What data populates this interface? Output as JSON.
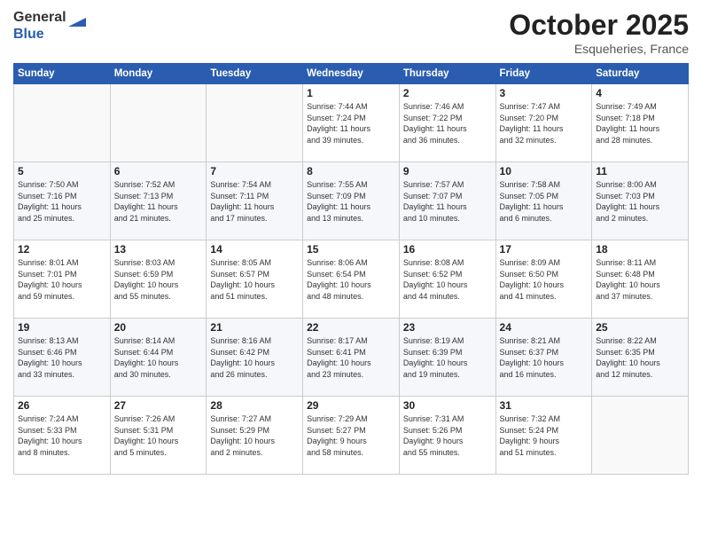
{
  "logo": {
    "general": "General",
    "blue": "Blue"
  },
  "header": {
    "month": "October 2025",
    "location": "Esqueheries, France"
  },
  "weekdays": [
    "Sunday",
    "Monday",
    "Tuesday",
    "Wednesday",
    "Thursday",
    "Friday",
    "Saturday"
  ],
  "weeks": [
    [
      {
        "day": "",
        "info": ""
      },
      {
        "day": "",
        "info": ""
      },
      {
        "day": "",
        "info": ""
      },
      {
        "day": "1",
        "info": "Sunrise: 7:44 AM\nSunset: 7:24 PM\nDaylight: 11 hours\nand 39 minutes."
      },
      {
        "day": "2",
        "info": "Sunrise: 7:46 AM\nSunset: 7:22 PM\nDaylight: 11 hours\nand 36 minutes."
      },
      {
        "day": "3",
        "info": "Sunrise: 7:47 AM\nSunset: 7:20 PM\nDaylight: 11 hours\nand 32 minutes."
      },
      {
        "day": "4",
        "info": "Sunrise: 7:49 AM\nSunset: 7:18 PM\nDaylight: 11 hours\nand 28 minutes."
      }
    ],
    [
      {
        "day": "5",
        "info": "Sunrise: 7:50 AM\nSunset: 7:16 PM\nDaylight: 11 hours\nand 25 minutes."
      },
      {
        "day": "6",
        "info": "Sunrise: 7:52 AM\nSunset: 7:13 PM\nDaylight: 11 hours\nand 21 minutes."
      },
      {
        "day": "7",
        "info": "Sunrise: 7:54 AM\nSunset: 7:11 PM\nDaylight: 11 hours\nand 17 minutes."
      },
      {
        "day": "8",
        "info": "Sunrise: 7:55 AM\nSunset: 7:09 PM\nDaylight: 11 hours\nand 13 minutes."
      },
      {
        "day": "9",
        "info": "Sunrise: 7:57 AM\nSunset: 7:07 PM\nDaylight: 11 hours\nand 10 minutes."
      },
      {
        "day": "10",
        "info": "Sunrise: 7:58 AM\nSunset: 7:05 PM\nDaylight: 11 hours\nand 6 minutes."
      },
      {
        "day": "11",
        "info": "Sunrise: 8:00 AM\nSunset: 7:03 PM\nDaylight: 11 hours\nand 2 minutes."
      }
    ],
    [
      {
        "day": "12",
        "info": "Sunrise: 8:01 AM\nSunset: 7:01 PM\nDaylight: 10 hours\nand 59 minutes."
      },
      {
        "day": "13",
        "info": "Sunrise: 8:03 AM\nSunset: 6:59 PM\nDaylight: 10 hours\nand 55 minutes."
      },
      {
        "day": "14",
        "info": "Sunrise: 8:05 AM\nSunset: 6:57 PM\nDaylight: 10 hours\nand 51 minutes."
      },
      {
        "day": "15",
        "info": "Sunrise: 8:06 AM\nSunset: 6:54 PM\nDaylight: 10 hours\nand 48 minutes."
      },
      {
        "day": "16",
        "info": "Sunrise: 8:08 AM\nSunset: 6:52 PM\nDaylight: 10 hours\nand 44 minutes."
      },
      {
        "day": "17",
        "info": "Sunrise: 8:09 AM\nSunset: 6:50 PM\nDaylight: 10 hours\nand 41 minutes."
      },
      {
        "day": "18",
        "info": "Sunrise: 8:11 AM\nSunset: 6:48 PM\nDaylight: 10 hours\nand 37 minutes."
      }
    ],
    [
      {
        "day": "19",
        "info": "Sunrise: 8:13 AM\nSunset: 6:46 PM\nDaylight: 10 hours\nand 33 minutes."
      },
      {
        "day": "20",
        "info": "Sunrise: 8:14 AM\nSunset: 6:44 PM\nDaylight: 10 hours\nand 30 minutes."
      },
      {
        "day": "21",
        "info": "Sunrise: 8:16 AM\nSunset: 6:42 PM\nDaylight: 10 hours\nand 26 minutes."
      },
      {
        "day": "22",
        "info": "Sunrise: 8:17 AM\nSunset: 6:41 PM\nDaylight: 10 hours\nand 23 minutes."
      },
      {
        "day": "23",
        "info": "Sunrise: 8:19 AM\nSunset: 6:39 PM\nDaylight: 10 hours\nand 19 minutes."
      },
      {
        "day": "24",
        "info": "Sunrise: 8:21 AM\nSunset: 6:37 PM\nDaylight: 10 hours\nand 16 minutes."
      },
      {
        "day": "25",
        "info": "Sunrise: 8:22 AM\nSunset: 6:35 PM\nDaylight: 10 hours\nand 12 minutes."
      }
    ],
    [
      {
        "day": "26",
        "info": "Sunrise: 7:24 AM\nSunset: 5:33 PM\nDaylight: 10 hours\nand 8 minutes."
      },
      {
        "day": "27",
        "info": "Sunrise: 7:26 AM\nSunset: 5:31 PM\nDaylight: 10 hours\nand 5 minutes."
      },
      {
        "day": "28",
        "info": "Sunrise: 7:27 AM\nSunset: 5:29 PM\nDaylight: 10 hours\nand 2 minutes."
      },
      {
        "day": "29",
        "info": "Sunrise: 7:29 AM\nSunset: 5:27 PM\nDaylight: 9 hours\nand 58 minutes."
      },
      {
        "day": "30",
        "info": "Sunrise: 7:31 AM\nSunset: 5:26 PM\nDaylight: 9 hours\nand 55 minutes."
      },
      {
        "day": "31",
        "info": "Sunrise: 7:32 AM\nSunset: 5:24 PM\nDaylight: 9 hours\nand 51 minutes."
      },
      {
        "day": "",
        "info": ""
      }
    ]
  ]
}
